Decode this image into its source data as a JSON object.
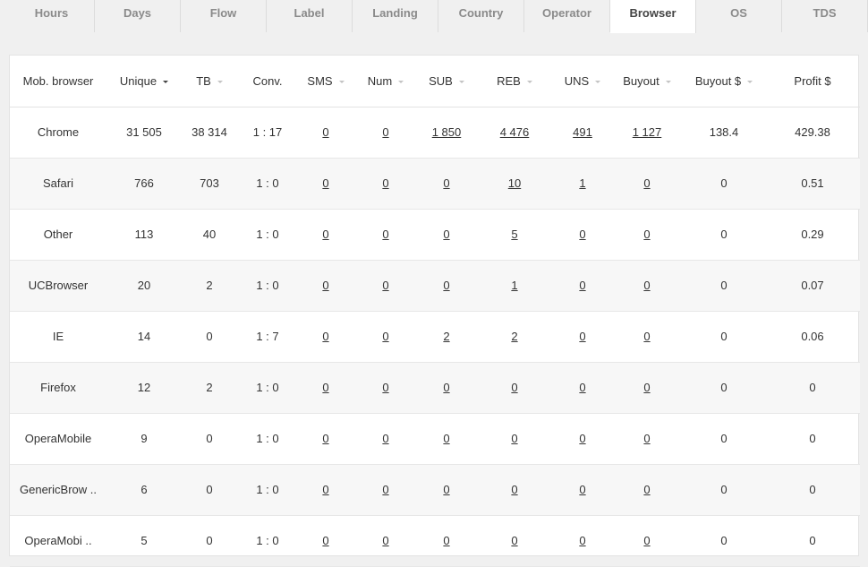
{
  "tabs": [
    {
      "label": "Hours",
      "active": false
    },
    {
      "label": "Days",
      "active": false
    },
    {
      "label": "Flow",
      "active": false
    },
    {
      "label": "Label",
      "active": false
    },
    {
      "label": "Landing",
      "active": false
    },
    {
      "label": "Country",
      "active": false
    },
    {
      "label": "Operator",
      "active": false
    },
    {
      "label": "Browser",
      "active": true
    },
    {
      "label": "OS",
      "active": false
    },
    {
      "label": "TDS",
      "active": false
    }
  ],
  "table": {
    "columns": [
      {
        "label": "Mob. browser",
        "sortable": false
      },
      {
        "label": "Unique",
        "sortable": true,
        "active": true
      },
      {
        "label": "TB",
        "sortable": true
      },
      {
        "label": "Conv.",
        "sortable": false
      },
      {
        "label": "SMS",
        "sortable": true
      },
      {
        "label": "Num",
        "sortable": true
      },
      {
        "label": "SUB",
        "sortable": true
      },
      {
        "label": "REB",
        "sortable": true
      },
      {
        "label": "UNS",
        "sortable": true
      },
      {
        "label": "Buyout",
        "sortable": true
      },
      {
        "label": "Buyout $",
        "sortable": true
      },
      {
        "label": "Profit $",
        "sortable": false
      }
    ],
    "link_columns": [
      4,
      5,
      6,
      7,
      8,
      9
    ],
    "rows": [
      [
        "Chrome",
        "31 505",
        "38 314",
        "1 : 17",
        "0",
        "0",
        "1 850",
        "4 476",
        "491",
        "1 127",
        "138.4",
        "429.38"
      ],
      [
        "Safari",
        "766",
        "703",
        "1 : 0",
        "0",
        "0",
        "0",
        "10",
        "1",
        "0",
        "0",
        "0.51"
      ],
      [
        "Other",
        "113",
        "40",
        "1 : 0",
        "0",
        "0",
        "0",
        "5",
        "0",
        "0",
        "0",
        "0.29"
      ],
      [
        "UCBrowser",
        "20",
        "2",
        "1 : 0",
        "0",
        "0",
        "0",
        "1",
        "0",
        "0",
        "0",
        "0.07"
      ],
      [
        "IE",
        "14",
        "0",
        "1 : 7",
        "0",
        "0",
        "2",
        "2",
        "0",
        "0",
        "0",
        "0.06"
      ],
      [
        "Firefox",
        "12",
        "2",
        "1 : 0",
        "0",
        "0",
        "0",
        "0",
        "0",
        "0",
        "0",
        "0"
      ],
      [
        "OperaMobile",
        "9",
        "0",
        "1 : 0",
        "0",
        "0",
        "0",
        "0",
        "0",
        "0",
        "0",
        "0"
      ],
      [
        "GenericBrow ..",
        "6",
        "0",
        "1 : 0",
        "0",
        "0",
        "0",
        "0",
        "0",
        "0",
        "0",
        "0"
      ],
      [
        "OperaMobi ..",
        "5",
        "0",
        "1 : 0",
        "0",
        "0",
        "0",
        "0",
        "0",
        "0",
        "0",
        "0"
      ]
    ]
  }
}
